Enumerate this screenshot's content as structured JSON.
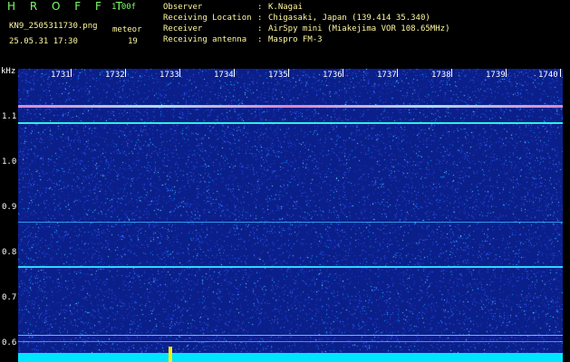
{
  "header": {
    "app_title": "H R O F F T",
    "version": "1.00f",
    "file_name": "KN9_2505311730.png",
    "meteor_label": "meteor",
    "datetime": "25.05.31 17:30",
    "meteor_count": "19"
  },
  "meta": [
    {
      "key": "Observer",
      "sep": ":",
      "value": "K.Nagai"
    },
    {
      "key": "Receiving Location",
      "sep": ":",
      "value": "Chigasaki, Japan (139.414 35.340)"
    },
    {
      "key": "Receiver",
      "sep": ":",
      "value": "AirSpy mini (Miakejima VOR 108.65MHz)"
    },
    {
      "key": "Receiving antenna",
      "sep": ":",
      "value": "Maspro FM-3"
    }
  ],
  "axis": {
    "y_unit": "kHz",
    "y_labels": [
      "1.1",
      "1.0",
      "0.9",
      "0.8",
      "0.7",
      "0.6"
    ],
    "x_labels": [
      "1731",
      "1732",
      "1733",
      "1734",
      "1735",
      "1736",
      "1737",
      "1738",
      "1739",
      "1740"
    ]
  },
  "colors": {
    "background": "#000000",
    "plot_bg": "#0b1f8a",
    "header_green": "#7cfc6a",
    "header_yellow": "#fff8a0",
    "band_cyan": "#00e5ff"
  }
}
